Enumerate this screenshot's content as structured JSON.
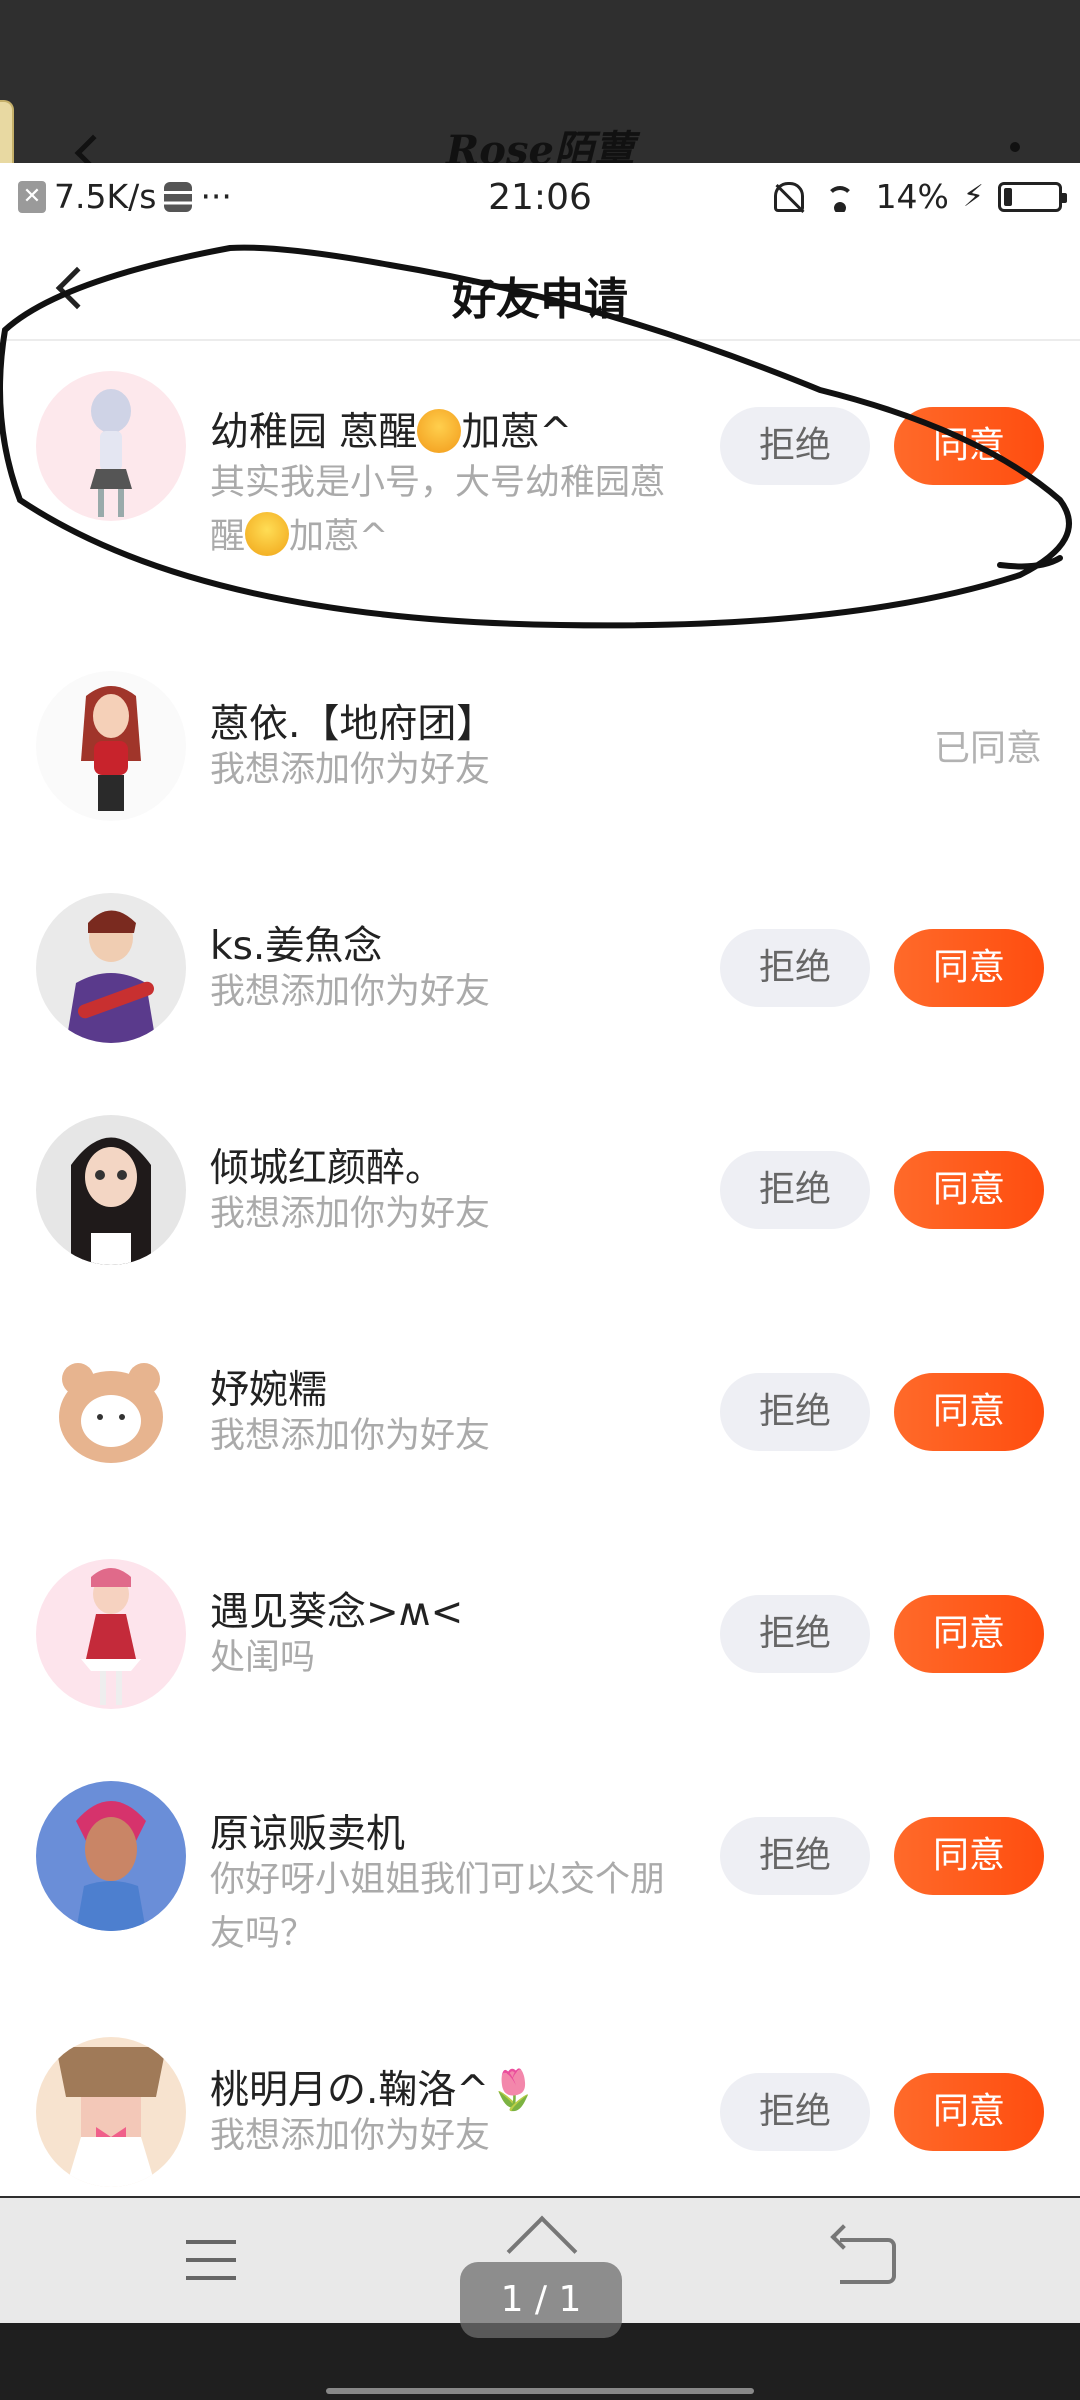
{
  "underlying": {
    "title": "Rose陌蕈"
  },
  "status_bar": {
    "net_speed": "7.5K/s",
    "more": "···",
    "time": "21:06",
    "battery_text": "14%",
    "battery_level": 0.14
  },
  "header": {
    "title": "好友申请"
  },
  "buttons": {
    "reject": "拒绝",
    "accept": "同意",
    "accepted": "已同意"
  },
  "requests": [
    {
      "name_a": "幼稚园 蒽醒",
      "name_b": "加蒽^",
      "msg_a": "其实我是小号，大号幼稚园蒽醒",
      "msg_b": "加蒽^",
      "state": "pending"
    },
    {
      "name": "蒽依.【地府团】",
      "msg": "我想添加你为好友",
      "state": "accepted"
    },
    {
      "name": "ks.姜魚念",
      "msg": "我想添加你为好友",
      "state": "pending"
    },
    {
      "name": "倾城红颜醉。",
      "msg": "我想添加你为好友",
      "state": "pending"
    },
    {
      "name": "妤婉糯",
      "msg": "我想添加你为好友",
      "state": "pending"
    },
    {
      "name": "遇见葵念>ʍ<",
      "msg": "处闺吗",
      "state": "pending"
    },
    {
      "name": "原谅贩卖机",
      "msg": "你好呀小姐姐我们可以交个朋友吗？",
      "state": "pending"
    },
    {
      "name": "桃明月の.鞠洛^",
      "msg": "我想添加你为好友",
      "state": "pending"
    }
  ],
  "pager": {
    "label": "1 / 1"
  },
  "colors": {
    "accent": "#ff5a1a",
    "reject_bg": "#eeeff4",
    "muted_text": "#aaaaaa"
  }
}
